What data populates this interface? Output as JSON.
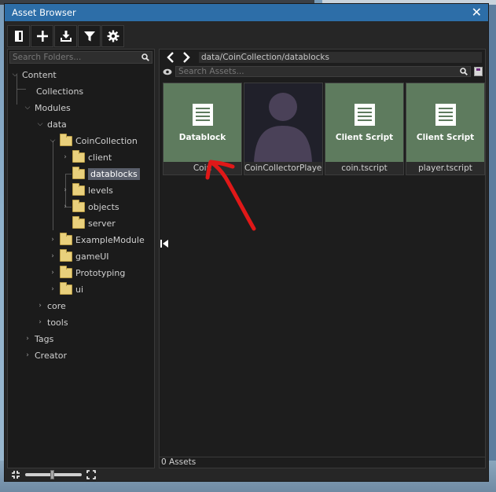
{
  "window": {
    "title": "Asset Browser",
    "close_glyph": "✕"
  },
  "toolbar": [
    {
      "name": "new-folder-button",
      "icon": "panel-icon"
    },
    {
      "name": "add-button",
      "icon": "plus-icon"
    },
    {
      "name": "import-button",
      "icon": "download-icon"
    },
    {
      "name": "filter-button",
      "icon": "filter-icon"
    },
    {
      "name": "settings-button",
      "icon": "gear-icon"
    }
  ],
  "folders": {
    "search_placeholder": "Search Folders...",
    "tree": {
      "content": "Content",
      "collections": "Collections",
      "modules": "Modules",
      "data": "data",
      "coin_collection": "CoinCollection",
      "client": "client",
      "datablocks": "datablocks",
      "levels": "levels",
      "objects": "objects",
      "server": "server",
      "example_module": "ExampleModule",
      "game_ui": "gameUI",
      "prototyping": "Prototyping",
      "ui": "ui",
      "core": "core",
      "tools": "tools",
      "tags": "Tags",
      "creator": "Creator"
    }
  },
  "assets": {
    "path": "data/CoinCollection/datablocks",
    "search_placeholder": "Search Assets...",
    "items": [
      {
        "type_label": "Datablock",
        "name": "Coin"
      },
      {
        "type_label": "",
        "name": "CoinCollectorPlayer"
      },
      {
        "type_label": "Client Script",
        "name": "coin.tscript"
      },
      {
        "type_label": "Client Script",
        "name": "player.tscript"
      }
    ],
    "status": "0 Assets"
  },
  "colors": {
    "titlebar": "#2d6ea8",
    "thumb_green": "#5e7b5e",
    "annotation_red": "#e01818"
  }
}
